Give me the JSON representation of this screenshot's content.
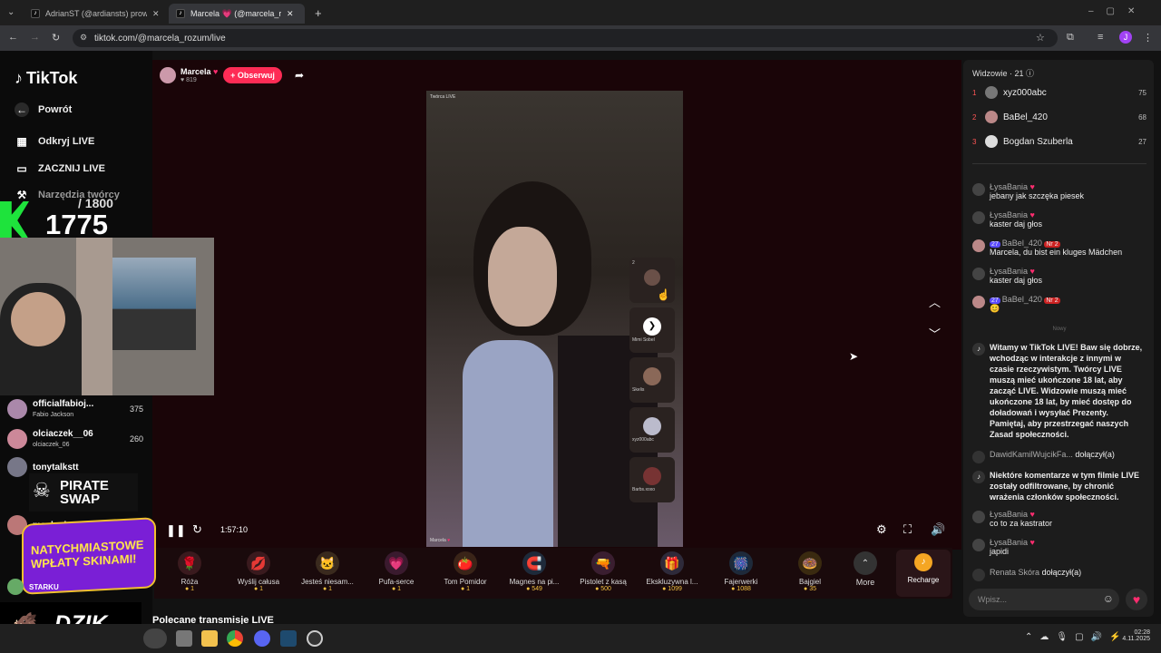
{
  "browser": {
    "tabs": [
      {
        "title": "AdrianST (@ardiansts) prowadz..."
      },
      {
        "title": "Marcela 💗 (@marcela_rozu..."
      }
    ],
    "url": "tiktok.com/@marcela_rozum/live"
  },
  "sidebar": {
    "logo": "TikTok",
    "back": "Powrót",
    "items": [
      {
        "label": "Odkryj LIVE"
      },
      {
        "label": "ZACZNIJ LIVE"
      },
      {
        "label": "Narzędzia twórcy"
      }
    ]
  },
  "overlay": {
    "goal_total": "/ 1800",
    "goal_current": "1775",
    "pirate": "PIRATE SWAP",
    "promo": "NATYCHMIASTOWE WPŁATY SKINAMI!",
    "brand": "DZIK.",
    "list": [
      {
        "name": "officialfabioj...",
        "sub": "Fabio Jackson",
        "count": "375"
      },
      {
        "name": "olciaczek__06",
        "sub": "olciaczek_06",
        "count": "260"
      },
      {
        "name": "tonytalkstt",
        "sub": "",
        "count": ""
      },
      {
        "name": "maskedasmrr",
        "sub": "",
        "count": ""
      },
      {
        "name": "STARKU",
        "sub": "",
        "count": ""
      }
    ]
  },
  "stream": {
    "host": "Marcela",
    "likes": "819",
    "follow": "+ Obserwuj",
    "time": "1:57:10",
    "video_label": "Twórca LIVE"
  },
  "side_cards": [
    {
      "label": "2"
    },
    {
      "label": "Mimi Sobel"
    },
    {
      "label": "Skelis"
    },
    {
      "label": "xyz000abc"
    },
    {
      "label": "Barbs.xoxo"
    }
  ],
  "gifts": [
    {
      "name": "Róża",
      "price": "1",
      "icon": "🌹"
    },
    {
      "name": "Wyślij całusa",
      "price": "1",
      "icon": "💋"
    },
    {
      "name": "Jesteś niesam...",
      "price": "1",
      "icon": "🐱"
    },
    {
      "name": "Pufa-serce",
      "price": "1",
      "icon": "💗"
    },
    {
      "name": "Tom Pomidor",
      "price": "1",
      "icon": "🍅"
    },
    {
      "name": "Magnes na pi...",
      "price": "549",
      "icon": "🧲"
    },
    {
      "name": "Pistolet z kasą",
      "price": "500",
      "icon": "🔫"
    },
    {
      "name": "Ekskluzywna l...",
      "price": "1099",
      "icon": "🎁"
    },
    {
      "name": "Fajerwerki",
      "price": "1088",
      "icon": "🎆"
    },
    {
      "name": "Bajgiel",
      "price": "35",
      "icon": "🍩"
    }
  ],
  "gift_more": "More",
  "recharge": "Recharge",
  "recommended": "Polecane transmisje LIVE",
  "viewers": {
    "title": "Widzowie · 21",
    "top": [
      {
        "rank": "1",
        "name": "xyz000abc",
        "count": "75"
      },
      {
        "rank": "2",
        "name": "BaBel_420",
        "count": "68"
      },
      {
        "rank": "3",
        "name": "Bogdan Szuberla",
        "count": "27"
      }
    ]
  },
  "chat": [
    {
      "user": "ŁysaBania",
      "text": "jebany jak szczęka piesek"
    },
    {
      "user": "ŁysaBania",
      "text": "kaster daj głos"
    },
    {
      "user": "BaBel_420",
      "badge": "27",
      "rank": "Nr 2",
      "text": "Marcela, du bist ein kluges Mädchen"
    },
    {
      "user": "ŁysaBania",
      "text": "kaster daj głos"
    },
    {
      "user": "BaBel_420",
      "badge": "27",
      "rank": "Nr 2",
      "text": "😊"
    }
  ],
  "chat_divider": "Nowy",
  "system_msg": "Witamy w TikTok LIVE! Baw się dobrze, wchodząc w interakcje z innymi w czasie rzeczywistym. Twórcy LIVE muszą mieć ukończone 18 lat, aby zacząć LIVE. Widzowie muszą mieć ukończone 18 lat, by mieć dostęp do doładowań i wysyłać Prezenty. Pamiętaj, aby przestrzegać naszych Zasad społeczności.",
  "join1": {
    "user": "DawidKamilWujcikFa...",
    "text": "dołączył(a)"
  },
  "filter_msg": "Niektóre komentarze w tym filmie LIVE zostały odfiltrowane, by chronić wrażenia członków społeczności.",
  "chat2": [
    {
      "user": "ŁysaBania",
      "text": "co to za kastrator"
    },
    {
      "user": "ŁysaBania",
      "text": "japidi"
    }
  ],
  "join2": {
    "user": "Renata Skóra",
    "text": "dołączył(a)"
  },
  "chat_input_placeholder": "Wpisz...",
  "clock": {
    "time": "02:28",
    "date": "4.11.2025"
  }
}
